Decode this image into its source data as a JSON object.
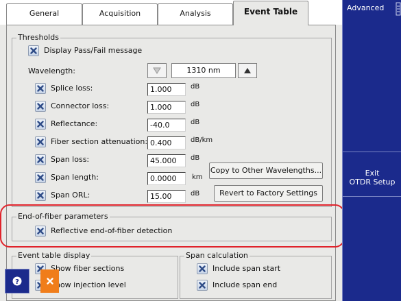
{
  "tabs": [
    {
      "label": "General"
    },
    {
      "label": "Acquisition"
    },
    {
      "label": "Analysis"
    },
    {
      "label": "Event Table"
    }
  ],
  "thresholds": {
    "title": "Thresholds",
    "display_pass_fail": "Display Pass/Fail message",
    "wavelength_label": "Wavelength:",
    "wavelength_value": "1310 nm",
    "rows": [
      {
        "label": "Splice loss:",
        "value": "1.000",
        "unit": "dB"
      },
      {
        "label": "Connector loss:",
        "value": "1.000",
        "unit": "dB"
      },
      {
        "label": "Reflectance:",
        "value": "-40.0",
        "unit": "dB"
      },
      {
        "label": "Fiber section attenuation:",
        "value": "0.400",
        "unit": "dB/km"
      },
      {
        "label": "Span loss:",
        "value": "45.000",
        "unit": "dB"
      },
      {
        "label": "Span length:",
        "value": "0.0000",
        "unit": "km"
      },
      {
        "label": "Span ORL:",
        "value": "15.00",
        "unit": "dB"
      }
    ],
    "copy_button": "Copy to Other Wavelengths...",
    "revert_button": "Revert to Factory Settings"
  },
  "end_of_fiber": {
    "title": "End-of-fiber parameters",
    "reflective": "Reflective end-of-fiber detection"
  },
  "event_table_display": {
    "title": "Event table display",
    "show_fiber_sections": "Show fiber sections",
    "show_injection_level": "Show injection level"
  },
  "span_calculation": {
    "title": "Span calculation",
    "include_span_start": "Include span start",
    "include_span_end": "Include span end"
  },
  "sidebar": {
    "advanced": "Advanced",
    "exit_line1": "Exit",
    "exit_line2": "OTDR Setup"
  },
  "colors": {
    "sidebar_bg": "#1b2a8c",
    "highlight": "#e0232b",
    "close_button": "#f07d1a"
  }
}
